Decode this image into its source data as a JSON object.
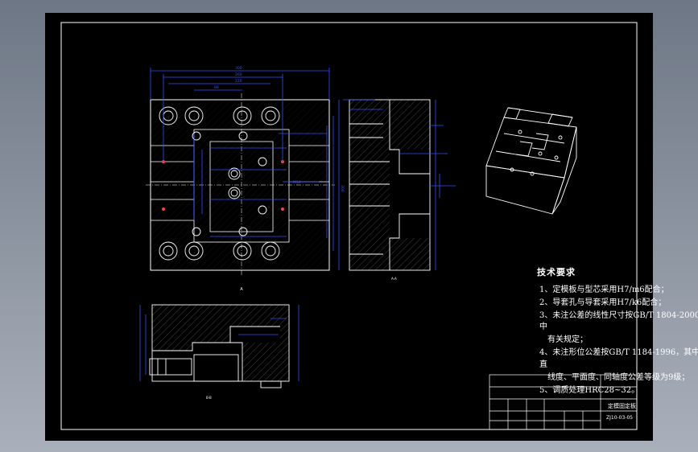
{
  "notes": {
    "title": "技术要求",
    "lines": [
      "1、定模板与型芯采用H7/m6配合；",
      "2、导套孔与导套采用H7/k6配合；",
      "3、未注公差的线性尺寸按GB/T 1804-2000",
      "中",
      "有关规定；",
      "4、未注形位公差按GB/T 1184-1996，其中",
      "直",
      "线度、平面度、同轴度公差等级为9级；",
      "5、调质处理HRC28~32。"
    ]
  },
  "title_block": {
    "part_name": "定模固定板",
    "drawing_no": "ZJ10-03-05"
  },
  "views": {
    "side_label": "A-A",
    "bottom_label": "B-B"
  }
}
